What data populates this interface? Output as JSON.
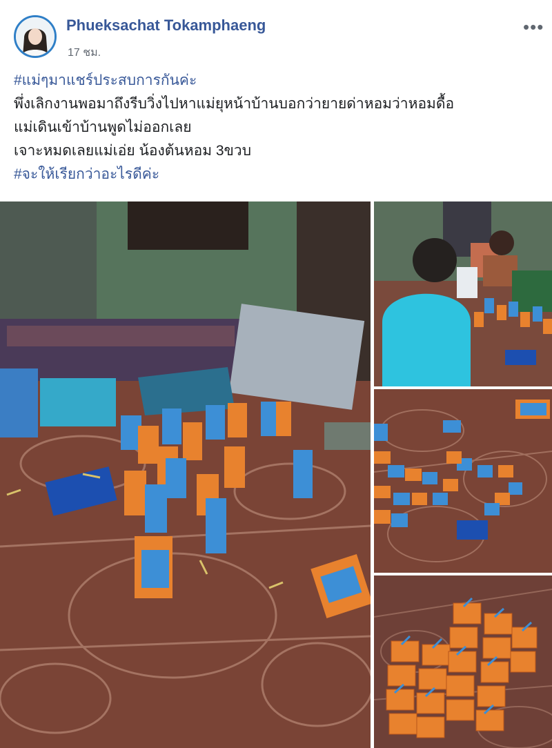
{
  "post": {
    "author": "Phueksachat Tokamphaeng",
    "timestamp": "17 ชม.",
    "more_icon": "more-horizontal-icon",
    "lines": [
      "#แม่ๆมาแชร์ประสบการกันค่ะ",
      "พึ่งเลิกงานพอมาถึงรีบวิ่งไปหาแม่ยุหน้าบ้านบอกว่ายายด่าหอมว่าหอมดื้อ",
      "แม่เดินเข้าบ้านพูดไม่ออกเลย",
      "เจาะหมดเลยแม่เอ่ย น้องต้นหอม 3ขวบ",
      "#จะให้เรียกว่าอะไรดีค่ะ"
    ]
  },
  "photos": [
    "photo-milk-boxes-floor",
    "photo-child-with-boxes",
    "photo-boxes-scattered",
    "photo-boxes-stacked"
  ],
  "colors": {
    "link": "#385898",
    "text": "#1c1e21",
    "meta": "#606770",
    "milk_box_orange": "#e8822e",
    "milk_box_blue": "#3d8fd6",
    "floor": "#7a4436",
    "wall": "#56745c"
  }
}
